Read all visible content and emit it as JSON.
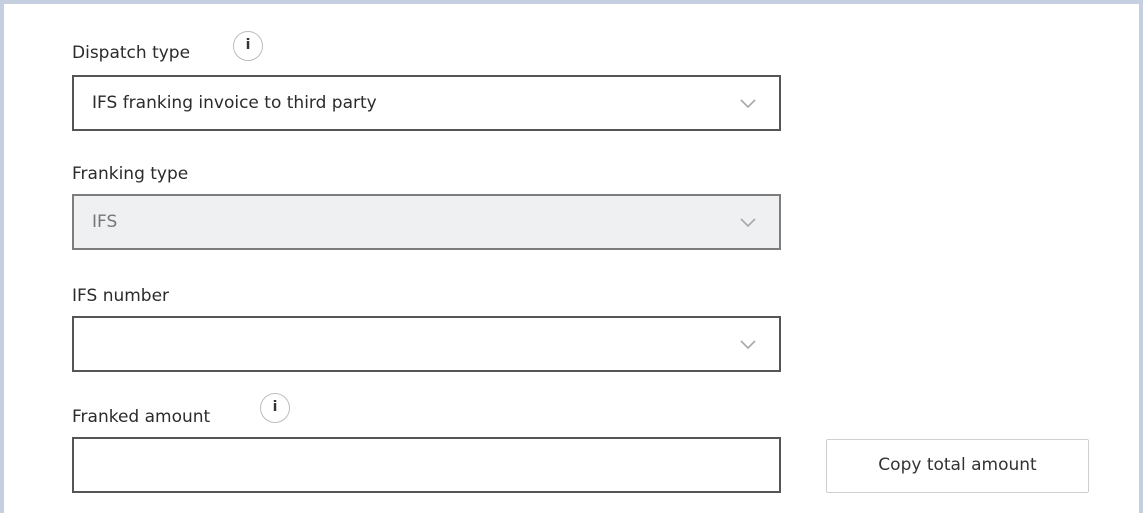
{
  "dispatch": {
    "label": "Dispatch type",
    "info_icon": "i",
    "selected": "IFS franking invoice to third party"
  },
  "franking": {
    "label": "Franking type",
    "selected": "IFS",
    "disabled": true
  },
  "ifs_number": {
    "label": "IFS number",
    "selected": ""
  },
  "franked_amount": {
    "label": "Franked amount",
    "info_icon": "i",
    "value": ""
  },
  "actions": {
    "copy_total_label": "Copy total amount"
  },
  "colors": {
    "frame_border": "#c5cfe0",
    "field_border": "#555555",
    "disabled_background": "#eef0f2",
    "disabled_text": "#767676"
  },
  "icons": [
    "info-icon",
    "chevron-down-icon"
  ]
}
